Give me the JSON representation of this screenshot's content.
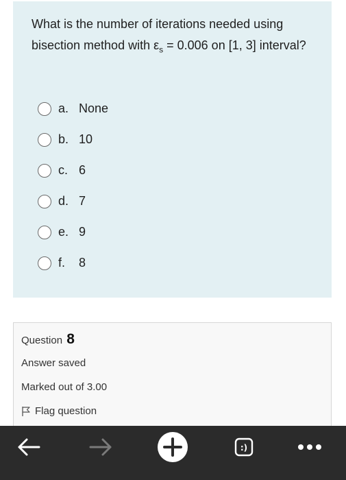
{
  "question": {
    "text_before": "What is the number of iterations needed using bisection method with ε",
    "subscript": "s",
    "text_after": " = 0.006 on [1, 3] interval?",
    "options": [
      {
        "letter": "a.",
        "text": "None"
      },
      {
        "letter": "b.",
        "text": "10"
      },
      {
        "letter": "c.",
        "text": "6"
      },
      {
        "letter": "d.",
        "text": "7"
      },
      {
        "letter": "e.",
        "text": "9"
      },
      {
        "letter": "f.",
        "text": "8"
      }
    ]
  },
  "info": {
    "title_label": "Question",
    "number": "8",
    "status": "Answer saved",
    "marks": "Marked out of 3.00",
    "flag_label": "Flag question"
  },
  "toolbar": {
    "back_icon": "back-arrow-icon",
    "forward_icon": "forward-arrow-icon",
    "new_tab_icon": "plus-icon",
    "tabs_icon": "tabs-icon",
    "tabs_label": ":)",
    "menu_icon": "more-icon",
    "colors": {
      "background": "#2b2b2b",
      "active": "#ffffff",
      "disabled": "#7a7a7a"
    }
  }
}
